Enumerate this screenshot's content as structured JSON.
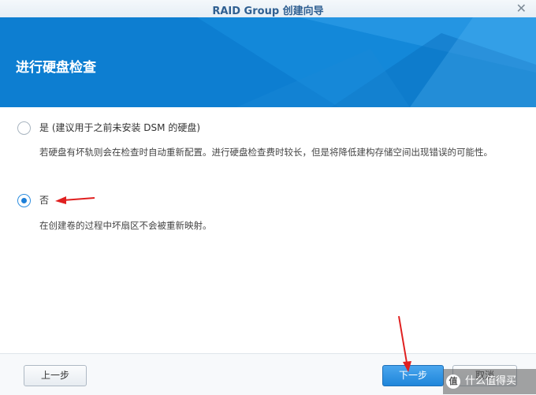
{
  "window": {
    "title": "RAID Group 创建向导",
    "close_glyph": "✕"
  },
  "banner": {
    "title": "进行硬盘检查"
  },
  "options": [
    {
      "label": "是 (建议用于之前未安装 DSM 的硬盘)",
      "description": "若硬盘有坏轨则会在检查时自动重新配置。进行硬盘检查费时较长，但是将降低建构存储空间出现错误的可能性。",
      "selected": false
    },
    {
      "label": "否",
      "description": "在创建卷的过程中坏扇区不会被重新映射。",
      "selected": true
    }
  ],
  "footer": {
    "prev_label": "上一步",
    "next_label": "下一步",
    "cancel_label": "取消"
  },
  "watermark": {
    "logo_char": "值",
    "text": "什么值得买"
  },
  "colors": {
    "banner": "#0d7ed1",
    "accent": "#1d7fd8",
    "annotation_arrow": "#e02020"
  }
}
